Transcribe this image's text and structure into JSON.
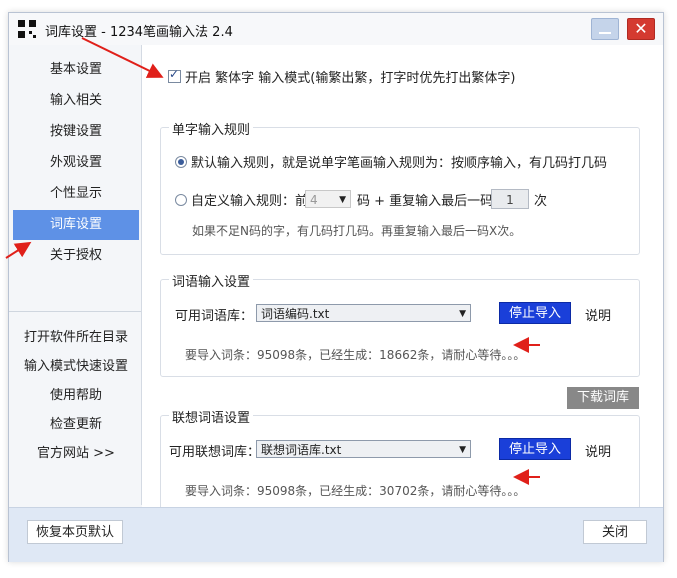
{
  "window": {
    "title": "词库设置 - 1234笔画输入法 2.4",
    "close_glyph": "✕"
  },
  "sidebar": {
    "items": [
      {
        "label": "基本设置"
      },
      {
        "label": "输入相关"
      },
      {
        "label": "按键设置"
      },
      {
        "label": "外观设置"
      },
      {
        "label": "个性显示"
      },
      {
        "label": "词库设置"
      },
      {
        "label": "关于授权"
      }
    ],
    "links": [
      {
        "label": "打开软件所在目录"
      },
      {
        "label": "输入模式快速设置"
      },
      {
        "label": "使用帮助"
      },
      {
        "label": "检查更新"
      },
      {
        "label": "官方网站 >>"
      }
    ]
  },
  "main": {
    "traditional_checkbox": "开启 繁体字 输入模式(输繁出繁，打字时优先打出繁体字)",
    "single_group": {
      "label": "单字输入规则",
      "default_rule": "默认输入规则，就是说单字笔画输入规则为：按顺序输入，有几码打几码",
      "custom_prefix": "自定义输入规则：前",
      "custom_select": "4",
      "custom_middle": "码 + 重复输入最后一码",
      "custom_repeat": "1",
      "custom_suffix": "次",
      "hint": "如果不足N码的字，有几码打几码。再重复输入最后一码X次。"
    },
    "phrase_group": {
      "label": "词语输入设置",
      "lib_label": "可用词语库：",
      "lib_value": "词语编码.txt",
      "stop_button": "停止导入",
      "explain": "说明",
      "progress": "要导入词条：95098条，已经生成：18662条，请耐心等待。。。"
    },
    "download_button": "下载词库",
    "assoc_group": {
      "label": "联想词语设置",
      "lib_label": "可用联想词库：",
      "lib_value": "联想词语库.txt",
      "stop_button": "停止导入",
      "explain": "说明",
      "progress": "要导入词条：95098条，已经生成：30702条，请耐心等待。。。"
    }
  },
  "footer": {
    "restore_button": "恢复本页默认",
    "close_button": "关闭"
  },
  "colors": {
    "accent": "#5e91e6",
    "stop_button": "#1a3fd9",
    "annotation_arrow": "#e0201a"
  }
}
